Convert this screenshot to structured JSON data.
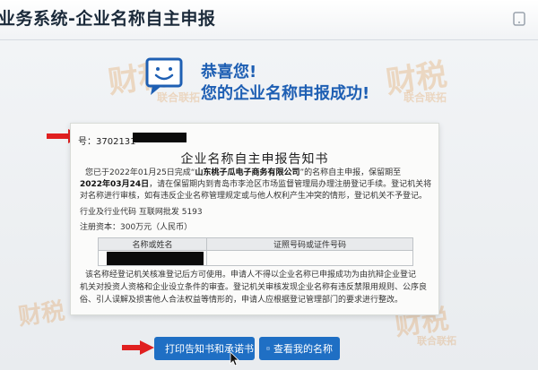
{
  "header": {
    "title": "业务系统-企业名称自主申报"
  },
  "watermark": {
    "text": "财税",
    "subtext": "联合联拓"
  },
  "success": {
    "congrats": "恭喜您!",
    "message": "您的企业名称申报成功!"
  },
  "notice": {
    "doc_no_label": "号：3702131",
    "title": "企业名称自主申报告知书",
    "para_prefix": "您已于2022年01月25日完成“",
    "company_name": "山东桃子瓜电子商务有限公司",
    "para_suffix": "”的名称自主申报，保留期至",
    "expiry_date": "2022年03月24日",
    "para_line2_rest": "，请在保留期内到青岛市李沧区市场监督管理局办理注册登记手续。登记机关将",
    "para_line3": "对名称进行审核，如有违反企业名称管理规定或与他人权利产生冲突的情形，登记机关不予登记。",
    "industry": "行业及行业代码    互联网批发 5193",
    "capital": "注册资本：300万元（人民币）",
    "table_headers": [
      "名称或姓名",
      "证照号码或证件号码"
    ],
    "footer_line1": "该名称经登记机关核准登记后方可使用。申请人不得以企业名称已申报成功为由抗辩企业登记",
    "footer_line2": "机关对投资人资格和企业设立条件的审查。登记机关审核发现企业名称有违反禁限用规则、公序良",
    "footer_line3": "俗、引人误解及损害他人合法权益等情形的，申请人应根据登记管理部门的要求进行整改。"
  },
  "buttons": {
    "print_label": "打印告知书和承诺书",
    "view_label": "查看我的名称"
  },
  "colors": {
    "accent": "#1e5fb3",
    "button": "#1f6fc4",
    "arrow": "#e02020"
  }
}
